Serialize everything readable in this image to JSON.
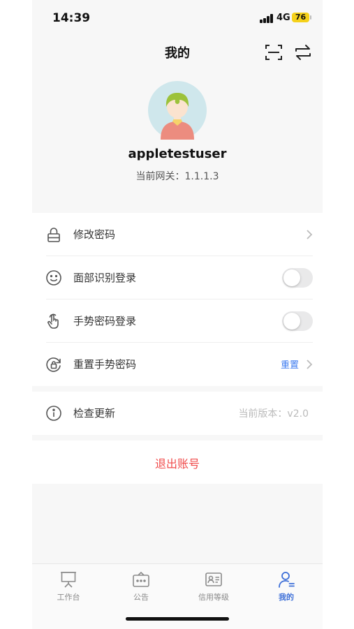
{
  "status_bar": {
    "time": "14:39",
    "network": "4G",
    "battery": "76"
  },
  "header": {
    "title": "我的",
    "scan_icon": "scan-icon",
    "switch_icon": "switch-icon"
  },
  "profile": {
    "avatar_icon": "avatar-illustration",
    "username": "appletestuser",
    "gateway": "当前网关：1.1.1.3"
  },
  "menu": {
    "change_password": {
      "label": "修改密码",
      "icon": "lock-icon"
    },
    "face_login": {
      "label": "面部识别登录",
      "icon": "smile-icon",
      "enabled": false
    },
    "gesture_login": {
      "label": "手势密码登录",
      "icon": "hand-icon",
      "enabled": false
    },
    "reset_gesture": {
      "label": "重置手势密码",
      "icon": "reset-lock-icon",
      "action": "重置"
    },
    "check_update": {
      "label": "检查更新",
      "icon": "info-icon",
      "version": "当前版本：v2.0"
    },
    "logout": {
      "label": "退出账号"
    }
  },
  "tabbar": {
    "tabs": [
      {
        "label": "工作台",
        "icon": "workbench-icon"
      },
      {
        "label": "公告",
        "icon": "announcement-icon"
      },
      {
        "label": "信用等级",
        "icon": "id-card-icon"
      },
      {
        "label": "我的",
        "icon": "person-icon"
      }
    ],
    "active": "我的"
  },
  "colors": {
    "accent": "#3d6fd8",
    "link": "#3d7bf0",
    "danger": "#f04a4a",
    "battery": "#f5d11a"
  }
}
